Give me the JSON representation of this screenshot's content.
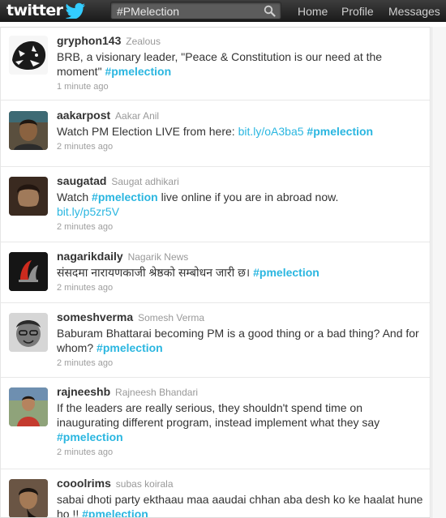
{
  "brand": {
    "logo_text": "twitter"
  },
  "search": {
    "value": "#PMelection"
  },
  "nav": {
    "home": "Home",
    "profile": "Profile",
    "messages": "Messages"
  },
  "tweets": [
    {
      "screen_name": "gryphon143",
      "full_name": "Zealous",
      "text_pre": "BRB, a visionary leader, \"Peace & Constitution is our need at the moment\"",
      "link": "",
      "text_post": "",
      "hashtag": "#pmelection",
      "time": "1 minute ago"
    },
    {
      "screen_name": "aakarpost",
      "full_name": "Aakar Anil",
      "text_pre": "Watch PM Election LIVE from here:",
      "link": "bit.ly/oA3ba5",
      "text_post": "",
      "hashtag": "#pmelection",
      "time": "2 minutes ago"
    },
    {
      "screen_name": "saugatad",
      "full_name": "Saugat adhikari",
      "text_pre": "Watch",
      "hashtag": "#pmelection",
      "text_post": "live online if you are in abroad now.",
      "link": "bit.ly/p5zr5V",
      "time": "2 minutes ago"
    },
    {
      "screen_name": "nagarikdaily",
      "full_name": "Nagarik News",
      "text_pre": "संसदमा नारायणकाजी श्रेष्ठको सम्बोधन जारी छ।",
      "link": "",
      "text_post": "",
      "hashtag": "#pmelection",
      "time": "2 minutes ago"
    },
    {
      "screen_name": "someshverma",
      "full_name": "Somesh Verma",
      "text_pre": "Baburam Bhattarai becoming PM is a good thing or a bad thing? And for whom?",
      "link": "",
      "text_post": "",
      "hashtag": "#pmelection",
      "time": "2 minutes ago"
    },
    {
      "screen_name": "rajneeshb",
      "full_name": "Rajneesh Bhandari",
      "text_pre": "If the leaders are really serious, they shouldn't spend time on inaugurating different program, instead implement what they say",
      "link": "",
      "text_post": "",
      "hashtag": "#pmelection",
      "time": "2 minutes ago"
    },
    {
      "screen_name": "cooolrims",
      "full_name": "subas koirala",
      "text_pre": "sabai dhoti party ekthaau maa aaudai chhan aba desh ko ke haalat hune ho !!",
      "link": "",
      "text_post": "",
      "hashtag": "#pmelection",
      "time": ""
    }
  ]
}
